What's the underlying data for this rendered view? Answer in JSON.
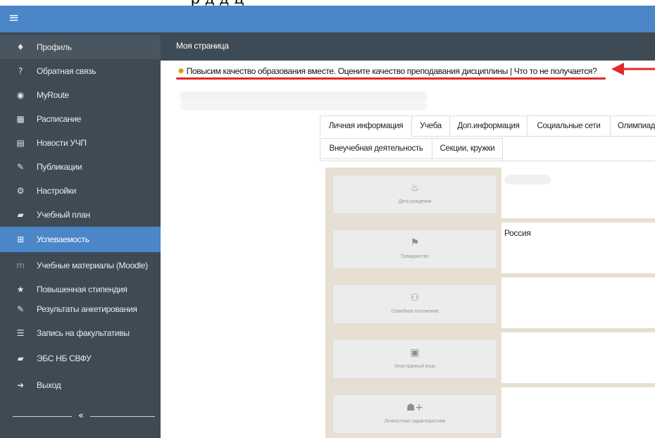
{
  "top_caption": "р   д   д   ц",
  "app": {
    "menu_icon": "hamburger-icon"
  },
  "sidebar": {
    "items": [
      {
        "label": "Профиль",
        "icon": "person-icon"
      },
      {
        "label": "Обратная связь",
        "icon": "question-icon"
      },
      {
        "label": "MyRoute",
        "icon": "target-icon"
      },
      {
        "label": "Расписание",
        "icon": "grid-icon"
      },
      {
        "label": "Новости УЧП",
        "icon": "newspaper-icon"
      },
      {
        "label": "Публикации",
        "icon": "edit-icon"
      },
      {
        "label": "Настройки",
        "icon": "gear-icon"
      },
      {
        "label": "Учебный план",
        "icon": "book-icon"
      },
      {
        "label": "Успеваемость",
        "icon": "plus-square-icon"
      },
      {
        "label": "Учебные материалы (Moodle)",
        "icon": "moodle-icon"
      },
      {
        "label": "Повышенная стипендия",
        "icon": "star-icon"
      },
      {
        "label": "Результаты анкетирования",
        "icon": "edit-icon"
      },
      {
        "label": "Запись на факультативы",
        "icon": "list-icon"
      },
      {
        "label": "ЭБС НБ СВФУ",
        "icon": "book-icon"
      },
      {
        "label": "Выход",
        "icon": "logout-icon"
      }
    ],
    "collapse_label": "«"
  },
  "header": {
    "title": "Моя страница"
  },
  "banner": {
    "icon": "sun-icon",
    "text": "Повысим качество образования вместе. Оцените качество преподавания дисциплины",
    "separator": "|",
    "link": "Что то не получается?"
  },
  "tabs": {
    "row1": [
      "Личная информация",
      "Учеба",
      "Доп.информация",
      "Социальные сети",
      "Олимпиад"
    ],
    "row2": [
      "Внеучебная деятельность",
      "Секции, кружки"
    ]
  },
  "info_rows": [
    {
      "label": "Дата рождения",
      "icon": "cake-icon",
      "value": ""
    },
    {
      "label": "Гражданство",
      "icon": "flag-icon",
      "value": "Россия"
    },
    {
      "label": "Семейное положение",
      "icon": "family-icon",
      "value": ""
    },
    {
      "label": "Иностранный язык",
      "icon": "language-icon",
      "value": ""
    },
    {
      "label": "Личностные характеристики",
      "icon": "user-add-icon",
      "value": ""
    }
  ],
  "colors": {
    "accent": "#4a86c8",
    "sidebar": "#3f4b54",
    "content_bg": "#e7e0d2",
    "annotation": "#e3282a"
  }
}
